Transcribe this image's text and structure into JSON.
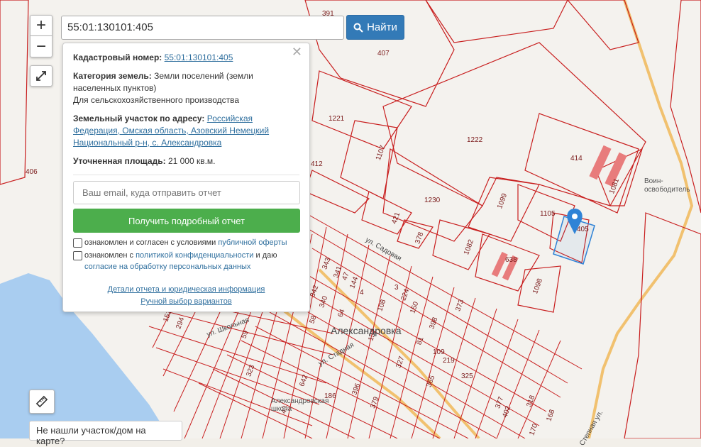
{
  "search": {
    "value": "55:01:130101:405",
    "button_label": "Найти"
  },
  "controls": {
    "zoom_in": "+",
    "zoom_out": "−"
  },
  "info": {
    "cadastral_label": "Кадастровый номер:",
    "cadastral_value": "55:01:130101:405",
    "category_label": "Категория земель:",
    "category_value": "Земли поселений (земли населенных пунктов)",
    "category_use": "Для сельскохозяйственного производства",
    "address_label": "Земельный участок по адресу:",
    "address_value": "Российская Федерация, Омская область, Азовский Немецкий Национальный р-н, с. Александровка",
    "area_label": "Уточненная площадь:",
    "area_value": "21 000 кв.м.",
    "email_placeholder": "Ваш email, куда отправить отчет",
    "report_button": "Получить подробный отчет",
    "consent1_text": "ознакомлен и согласен с условиями ",
    "consent1_link": "публичной оферты",
    "consent2_text": "ознакомлен с ",
    "consent2_link": "политикой конфиденциальности",
    "consent2_tail": " и даю",
    "consent2_link2": "согласие на обработку персональных данных",
    "details_link": "Детали отчета и юридическая информация",
    "manual_link": "Ручной выбор вариантов"
  },
  "not_found": "Не нашли участок/дом на карте?",
  "map": {
    "village": "Александровка",
    "poi_monument": "Воин-освободитель",
    "poi_school": "Александровская школа",
    "streets": [
      "ул. Стадная",
      "ул. Школьная",
      "ул. Садовая",
      "Степная ул."
    ],
    "parcels": [
      "391",
      "407",
      "1221",
      "1222",
      "414",
      "1081",
      "406",
      "1107",
      "412",
      "1230",
      "1099",
      "1105",
      "405",
      "421",
      "378",
      "1082",
      "638",
      "1098",
      "342",
      "343",
      "341",
      "47",
      "144",
      "4",
      "3",
      "224",
      "108",
      "150",
      "373",
      "340",
      "345",
      "55",
      "56",
      "2",
      "64",
      "58",
      "59",
      "294",
      "151",
      "132",
      "81",
      "398",
      "109",
      "219",
      "327",
      "325",
      "365",
      "323",
      "642",
      "186",
      "396",
      "379",
      "377",
      "402",
      "318",
      "43",
      "205",
      "179",
      "171",
      "170",
      "168",
      "419",
      "223",
      "202",
      "4"
    ]
  },
  "colors": {
    "accent": "#337ab7",
    "green": "#4cae4c",
    "parcel": "#c81e1e",
    "water": "#a9cdf0",
    "road": "#f6cd83",
    "selected": "#2f83d6"
  }
}
